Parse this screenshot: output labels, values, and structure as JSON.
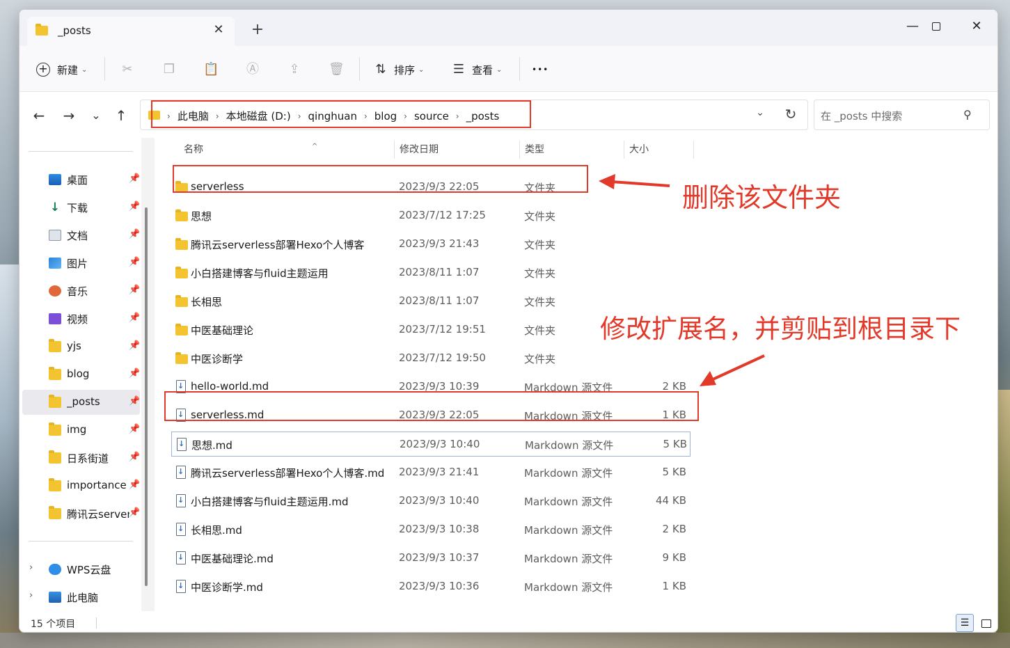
{
  "window": {
    "tab_title": "_posts",
    "tab_close_glyph": "✕",
    "new_tab_glyph": "+",
    "minimize_glyph": "—",
    "close_glyph": "✕"
  },
  "toolbar": {
    "new_label": "新建",
    "sort_label": "排序",
    "view_label": "查看",
    "more_glyph": "•••"
  },
  "navigation": {
    "back_glyph": "←",
    "forward_glyph": "→",
    "recent_glyph": "⌄",
    "up_glyph": "↑",
    "breadcrumbs": [
      "此电脑",
      "本地磁盘 (D:)",
      "qinghuan",
      "blog",
      "source",
      "_posts"
    ],
    "search_placeholder": "在 _posts 中搜索"
  },
  "sidebar": {
    "items": [
      {
        "label": "桌面",
        "icon": "desktop-icon",
        "pinned": true
      },
      {
        "label": "下载",
        "icon": "download-icon",
        "pinned": true
      },
      {
        "label": "文档",
        "icon": "document-icon",
        "pinned": true
      },
      {
        "label": "图片",
        "icon": "pictures-icon",
        "pinned": true
      },
      {
        "label": "音乐",
        "icon": "music-icon",
        "pinned": true
      },
      {
        "label": "视频",
        "icon": "video-icon",
        "pinned": true
      },
      {
        "label": "yjs",
        "icon": "folder-icon",
        "pinned": true
      },
      {
        "label": "blog",
        "icon": "folder-icon",
        "pinned": true
      },
      {
        "label": "_posts",
        "icon": "folder-icon",
        "pinned": true,
        "selected": true
      },
      {
        "label": "img",
        "icon": "folder-icon",
        "pinned": true
      },
      {
        "label": "日系街道",
        "icon": "folder-icon",
        "pinned": true
      },
      {
        "label": "importance",
        "icon": "folder-icon",
        "pinned": true
      },
      {
        "label": "腾讯云serverl",
        "icon": "folder-icon",
        "pinned": true
      }
    ],
    "locations": [
      {
        "label": "WPS云盘",
        "icon": "cloud-icon"
      },
      {
        "label": "此电脑",
        "icon": "computer-icon"
      }
    ]
  },
  "file_list": {
    "columns": [
      "名称",
      "修改日期",
      "类型",
      "大小"
    ],
    "rows": [
      {
        "name": "serverless",
        "date": "2023/9/3 22:05",
        "type": "文件夹",
        "size": "",
        "kind": "folder"
      },
      {
        "name": "思想",
        "date": "2023/7/12 17:25",
        "type": "文件夹",
        "size": "",
        "kind": "folder"
      },
      {
        "name": "腾讯云serverless部署Hexo个人博客",
        "date": "2023/9/3 21:43",
        "type": "文件夹",
        "size": "",
        "kind": "folder"
      },
      {
        "name": "小白搭建博客与fluid主题运用",
        "date": "2023/8/11 1:07",
        "type": "文件夹",
        "size": "",
        "kind": "folder"
      },
      {
        "name": "长相思",
        "date": "2023/8/11 1:07",
        "type": "文件夹",
        "size": "",
        "kind": "folder"
      },
      {
        "name": "中医基础理论",
        "date": "2023/7/12 19:51",
        "type": "文件夹",
        "size": "",
        "kind": "folder"
      },
      {
        "name": "中医诊断学",
        "date": "2023/7/12 19:50",
        "type": "文件夹",
        "size": "",
        "kind": "folder"
      },
      {
        "name": "hello-world.md",
        "date": "2023/9/3 10:39",
        "type": "Markdown 源文件",
        "size": "2 KB",
        "kind": "file"
      },
      {
        "name": "serverless.md",
        "date": "2023/9/3 22:05",
        "type": "Markdown 源文件",
        "size": "1 KB",
        "kind": "file"
      },
      {
        "name": "思想.md",
        "date": "2023/9/3 10:40",
        "type": "Markdown 源文件",
        "size": "5 KB",
        "kind": "file",
        "focused": true
      },
      {
        "name": "腾讯云serverless部署Hexo个人博客.md",
        "date": "2023/9/3 21:41",
        "type": "Markdown 源文件",
        "size": "5 KB",
        "kind": "file"
      },
      {
        "name": "小白搭建博客与fluid主题运用.md",
        "date": "2023/9/3 10:40",
        "type": "Markdown 源文件",
        "size": "44 KB",
        "kind": "file"
      },
      {
        "name": "长相思.md",
        "date": "2023/9/3 10:38",
        "type": "Markdown 源文件",
        "size": "2 KB",
        "kind": "file"
      },
      {
        "name": "中医基础理论.md",
        "date": "2023/9/3 10:37",
        "type": "Markdown 源文件",
        "size": "9 KB",
        "kind": "file"
      },
      {
        "name": "中医诊断学.md",
        "date": "2023/9/3 10:36",
        "type": "Markdown 源文件",
        "size": "1 KB",
        "kind": "file"
      }
    ]
  },
  "status": {
    "item_count": "15 个项目"
  },
  "annotations": {
    "delete_folder": "删除该文件夹",
    "rename_move": "修改扩展名，并剪贴到根目录下",
    "color": "#e23a2a"
  }
}
